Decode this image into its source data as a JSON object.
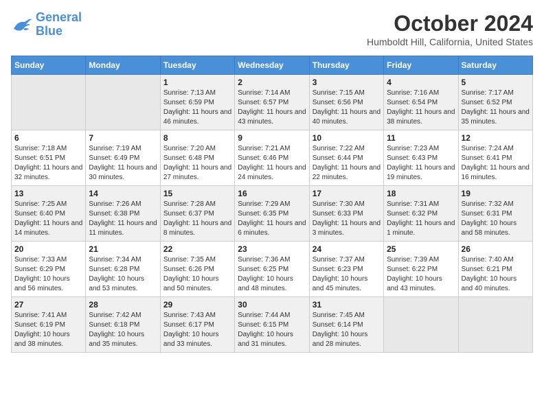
{
  "header": {
    "logo_line1": "General",
    "logo_line2": "Blue",
    "month_title": "October 2024",
    "location": "Humboldt Hill, California, United States"
  },
  "weekdays": [
    "Sunday",
    "Monday",
    "Tuesday",
    "Wednesday",
    "Thursday",
    "Friday",
    "Saturday"
  ],
  "weeks": [
    [
      {
        "day": "",
        "sunrise": "",
        "sunset": "",
        "daylight": "",
        "empty": true
      },
      {
        "day": "",
        "sunrise": "",
        "sunset": "",
        "daylight": "",
        "empty": true
      },
      {
        "day": "1",
        "sunrise": "Sunrise: 7:13 AM",
        "sunset": "Sunset: 6:59 PM",
        "daylight": "Daylight: 11 hours and 46 minutes."
      },
      {
        "day": "2",
        "sunrise": "Sunrise: 7:14 AM",
        "sunset": "Sunset: 6:57 PM",
        "daylight": "Daylight: 11 hours and 43 minutes."
      },
      {
        "day": "3",
        "sunrise": "Sunrise: 7:15 AM",
        "sunset": "Sunset: 6:56 PM",
        "daylight": "Daylight: 11 hours and 40 minutes."
      },
      {
        "day": "4",
        "sunrise": "Sunrise: 7:16 AM",
        "sunset": "Sunset: 6:54 PM",
        "daylight": "Daylight: 11 hours and 38 minutes."
      },
      {
        "day": "5",
        "sunrise": "Sunrise: 7:17 AM",
        "sunset": "Sunset: 6:52 PM",
        "daylight": "Daylight: 11 hours and 35 minutes."
      }
    ],
    [
      {
        "day": "6",
        "sunrise": "Sunrise: 7:18 AM",
        "sunset": "Sunset: 6:51 PM",
        "daylight": "Daylight: 11 hours and 32 minutes."
      },
      {
        "day": "7",
        "sunrise": "Sunrise: 7:19 AM",
        "sunset": "Sunset: 6:49 PM",
        "daylight": "Daylight: 11 hours and 30 minutes."
      },
      {
        "day": "8",
        "sunrise": "Sunrise: 7:20 AM",
        "sunset": "Sunset: 6:48 PM",
        "daylight": "Daylight: 11 hours and 27 minutes."
      },
      {
        "day": "9",
        "sunrise": "Sunrise: 7:21 AM",
        "sunset": "Sunset: 6:46 PM",
        "daylight": "Daylight: 11 hours and 24 minutes."
      },
      {
        "day": "10",
        "sunrise": "Sunrise: 7:22 AM",
        "sunset": "Sunset: 6:44 PM",
        "daylight": "Daylight: 11 hours and 22 minutes."
      },
      {
        "day": "11",
        "sunrise": "Sunrise: 7:23 AM",
        "sunset": "Sunset: 6:43 PM",
        "daylight": "Daylight: 11 hours and 19 minutes."
      },
      {
        "day": "12",
        "sunrise": "Sunrise: 7:24 AM",
        "sunset": "Sunset: 6:41 PM",
        "daylight": "Daylight: 11 hours and 16 minutes."
      }
    ],
    [
      {
        "day": "13",
        "sunrise": "Sunrise: 7:25 AM",
        "sunset": "Sunset: 6:40 PM",
        "daylight": "Daylight: 11 hours and 14 minutes."
      },
      {
        "day": "14",
        "sunrise": "Sunrise: 7:26 AM",
        "sunset": "Sunset: 6:38 PM",
        "daylight": "Daylight: 11 hours and 11 minutes."
      },
      {
        "day": "15",
        "sunrise": "Sunrise: 7:28 AM",
        "sunset": "Sunset: 6:37 PM",
        "daylight": "Daylight: 11 hours and 8 minutes."
      },
      {
        "day": "16",
        "sunrise": "Sunrise: 7:29 AM",
        "sunset": "Sunset: 6:35 PM",
        "daylight": "Daylight: 11 hours and 6 minutes."
      },
      {
        "day": "17",
        "sunrise": "Sunrise: 7:30 AM",
        "sunset": "Sunset: 6:33 PM",
        "daylight": "Daylight: 11 hours and 3 minutes."
      },
      {
        "day": "18",
        "sunrise": "Sunrise: 7:31 AM",
        "sunset": "Sunset: 6:32 PM",
        "daylight": "Daylight: 11 hours and 1 minute."
      },
      {
        "day": "19",
        "sunrise": "Sunrise: 7:32 AM",
        "sunset": "Sunset: 6:31 PM",
        "daylight": "Daylight: 10 hours and 58 minutes."
      }
    ],
    [
      {
        "day": "20",
        "sunrise": "Sunrise: 7:33 AM",
        "sunset": "Sunset: 6:29 PM",
        "daylight": "Daylight: 10 hours and 56 minutes."
      },
      {
        "day": "21",
        "sunrise": "Sunrise: 7:34 AM",
        "sunset": "Sunset: 6:28 PM",
        "daylight": "Daylight: 10 hours and 53 minutes."
      },
      {
        "day": "22",
        "sunrise": "Sunrise: 7:35 AM",
        "sunset": "Sunset: 6:26 PM",
        "daylight": "Daylight: 10 hours and 50 minutes."
      },
      {
        "day": "23",
        "sunrise": "Sunrise: 7:36 AM",
        "sunset": "Sunset: 6:25 PM",
        "daylight": "Daylight: 10 hours and 48 minutes."
      },
      {
        "day": "24",
        "sunrise": "Sunrise: 7:37 AM",
        "sunset": "Sunset: 6:23 PM",
        "daylight": "Daylight: 10 hours and 45 minutes."
      },
      {
        "day": "25",
        "sunrise": "Sunrise: 7:39 AM",
        "sunset": "Sunset: 6:22 PM",
        "daylight": "Daylight: 10 hours and 43 minutes."
      },
      {
        "day": "26",
        "sunrise": "Sunrise: 7:40 AM",
        "sunset": "Sunset: 6:21 PM",
        "daylight": "Daylight: 10 hours and 40 minutes."
      }
    ],
    [
      {
        "day": "27",
        "sunrise": "Sunrise: 7:41 AM",
        "sunset": "Sunset: 6:19 PM",
        "daylight": "Daylight: 10 hours and 38 minutes."
      },
      {
        "day": "28",
        "sunrise": "Sunrise: 7:42 AM",
        "sunset": "Sunset: 6:18 PM",
        "daylight": "Daylight: 10 hours and 35 minutes."
      },
      {
        "day": "29",
        "sunrise": "Sunrise: 7:43 AM",
        "sunset": "Sunset: 6:17 PM",
        "daylight": "Daylight: 10 hours and 33 minutes."
      },
      {
        "day": "30",
        "sunrise": "Sunrise: 7:44 AM",
        "sunset": "Sunset: 6:15 PM",
        "daylight": "Daylight: 10 hours and 31 minutes."
      },
      {
        "day": "31",
        "sunrise": "Sunrise: 7:45 AM",
        "sunset": "Sunset: 6:14 PM",
        "daylight": "Daylight: 10 hours and 28 minutes."
      },
      {
        "day": "",
        "sunrise": "",
        "sunset": "",
        "daylight": "",
        "empty": true
      },
      {
        "day": "",
        "sunrise": "",
        "sunset": "",
        "daylight": "",
        "empty": true
      }
    ]
  ]
}
